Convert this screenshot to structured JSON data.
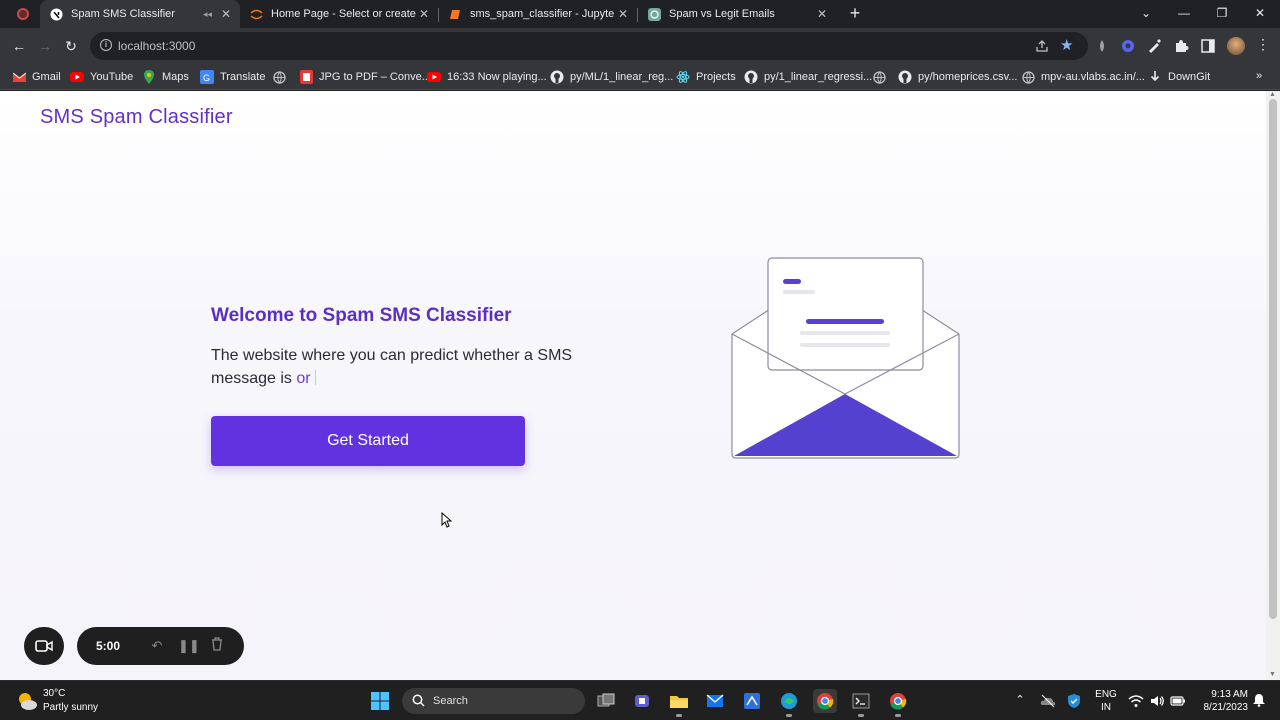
{
  "browser": {
    "tabs": [
      {
        "title": "Spam SMS Classifier",
        "active": true,
        "icon": "nextjs-icon"
      },
      {
        "title": "Home Page - Select or create a n",
        "active": false,
        "icon": "jupyter-icon"
      },
      {
        "title": "sms_spam_classifier - Jupyter Nc",
        "active": false,
        "icon": "notebook-icon"
      },
      {
        "title": "Spam vs Legit Emails",
        "active": false,
        "icon": "chatgpt-icon"
      }
    ],
    "url": "localhost:3000",
    "bookmarks": [
      {
        "label": "Gmail",
        "icon": "gmail-icon"
      },
      {
        "label": "YouTube",
        "icon": "youtube-icon"
      },
      {
        "label": "Maps",
        "icon": "maps-icon"
      },
      {
        "label": "Translate",
        "icon": "translate-icon"
      },
      {
        "label": "",
        "icon": "globe-icon"
      },
      {
        "label": "JPG to PDF – Conve...",
        "icon": "pdf-icon"
      },
      {
        "label": "16:33 Now playing...",
        "icon": "youtube-icon"
      },
      {
        "label": "py/ML/1_linear_reg...",
        "icon": "github-icon"
      },
      {
        "label": "Projects",
        "icon": "react-icon"
      },
      {
        "label": "py/1_linear_regressi...",
        "icon": "github-icon"
      },
      {
        "label": "",
        "icon": "globe-icon"
      },
      {
        "label": "py/homeprices.csv...",
        "icon": "github-icon"
      },
      {
        "label": "mpv-au.vlabs.ac.in/...",
        "icon": "globe-icon"
      },
      {
        "label": "DownGit",
        "icon": "download-icon"
      }
    ],
    "bookmarks_more": "»"
  },
  "page": {
    "brand": "SMS Spam Classifier",
    "hero_title": "Welcome to Spam SMS Classifier",
    "hero_text": "The website where you can predict whether a SMS message is",
    "hero_accent": "or",
    "cta_label": "Get Started",
    "colors": {
      "accent": "#6232e0",
      "brand": "#6231c9"
    }
  },
  "recorder": {
    "time": "5:00"
  },
  "taskbar": {
    "weather_temp": "30°C",
    "weather_desc": "Partly sunny",
    "search_label": "Search",
    "lang_1": "ENG",
    "lang_2": "IN",
    "time": "9:13 AM",
    "date": "8/21/2023"
  }
}
